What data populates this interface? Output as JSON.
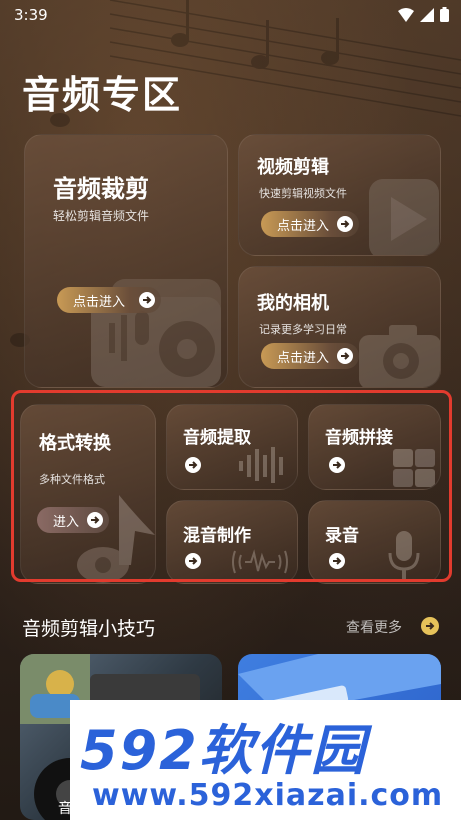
{
  "status": {
    "time": "3:39"
  },
  "page_title": "音频专区",
  "featured": {
    "audio_cut": {
      "title": "音频裁剪",
      "subtitle": "轻松剪辑音频文件",
      "button": "点击进入"
    },
    "video_edit": {
      "title": "视频剪辑",
      "subtitle": "快速剪辑视频文件",
      "button": "点击进入"
    },
    "my_camera": {
      "title": "我的相机",
      "subtitle": "记录更多学习日常",
      "button": "点击进入"
    }
  },
  "tools": {
    "format_convert": {
      "title": "格式转换",
      "subtitle": "多种文件格式",
      "button": "进入"
    },
    "audio_extract": {
      "title": "音频提取"
    },
    "audio_splice": {
      "title": "音频拼接"
    },
    "audio_mix": {
      "title": "混音制作"
    },
    "record": {
      "title": "录音"
    }
  },
  "tips": {
    "title": "音频剪辑小技巧",
    "more": "查看更多"
  },
  "watermark": {
    "logo": "592软件园",
    "url": "www.592xiazai.com"
  },
  "bottom_partial_label": "音",
  "colors": {
    "highlight_border": "#e23b2e",
    "accent_gold": "#c89a55",
    "watermark_blue": "#2b62d9"
  }
}
